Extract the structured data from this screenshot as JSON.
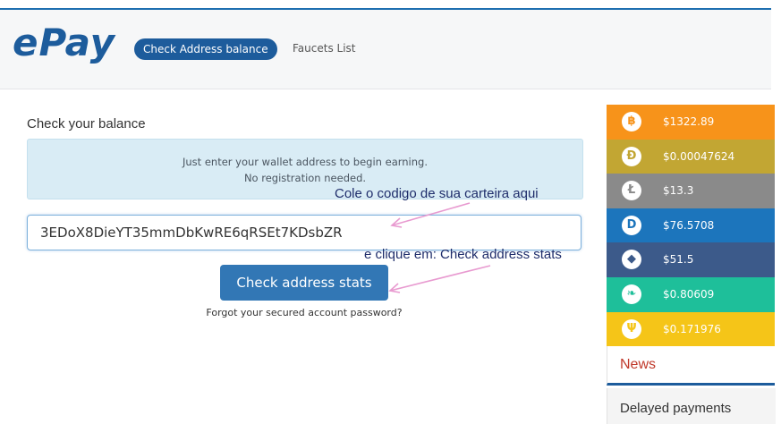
{
  "header": {
    "logo_text": "ePay",
    "nav_active_label": "Check Address balance",
    "nav_link_label": "Faucets List"
  },
  "main": {
    "section_title": "Check your balance",
    "info_line_1": "Just enter your wallet address to begin earning.",
    "info_line_2": "No registration needed.",
    "annotation_1": "Cole o codigo de sua carteira aqui",
    "annotation_2": "e clique em: Check address stats",
    "address_value": "3EDoX8DieYT35mmDbKwRE6qRSEt7KDsbZR",
    "check_button_label": "Check address stats",
    "forgot_link": "Forgot your secured account password?"
  },
  "sidebar": {
    "coins": [
      {
        "icon": "bitcoin-icon",
        "symbol": "฿",
        "price": "$1322.89",
        "color": "#f7931a",
        "icon_color": "#f7931a"
      },
      {
        "icon": "dogecoin-icon",
        "symbol": "Đ",
        "price": "$0.00047624",
        "color": "#c2a633",
        "icon_color": "#c2a633"
      },
      {
        "icon": "litecoin-icon",
        "symbol": "Ł",
        "price": "$13.3",
        "color": "#8a8a8a",
        "icon_color": "#8a8a8a"
      },
      {
        "icon": "dash-icon",
        "symbol": "D",
        "price": "$76.5708",
        "color": "#1c75bc",
        "icon_color": "#1c75bc"
      },
      {
        "icon": "ethereum-icon",
        "symbol": "◆",
        "price": "$51.5",
        "color": "#3c5a8a",
        "icon_color": "#3c5a8a"
      },
      {
        "icon": "peercoin-icon",
        "symbol": "❧",
        "price": "$0.80609",
        "color": "#1ebf9a",
        "icon_color": "#1ebf9a"
      },
      {
        "icon": "primecoin-icon",
        "symbol": "Ψ",
        "price": "$0.171976",
        "color": "#f5c518",
        "icon_color": "#f5c518"
      }
    ],
    "news_label": "News",
    "delayed_label": "Delayed payments"
  }
}
